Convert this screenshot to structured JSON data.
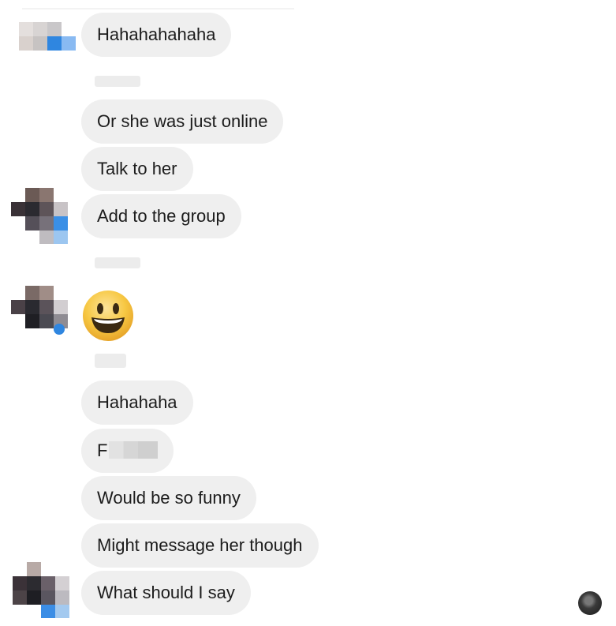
{
  "messages": [
    {
      "text": "Hahahahahaha"
    },
    {
      "text": "Or she was just online"
    },
    {
      "text": "Talk to her"
    },
    {
      "text": "Add to the group"
    },
    {
      "emoji": "smiling-face"
    },
    {
      "text": "Hahahaha"
    },
    {
      "text": "F"
    },
    {
      "text": "Would be so funny"
    },
    {
      "text": "Might message her though"
    },
    {
      "text": "What should I say"
    }
  ],
  "colors": {
    "bubble": "#efefef",
    "text": "#1c1c1c",
    "emoji": "#f6c443",
    "avatar_accent": "#3d8ee8"
  }
}
